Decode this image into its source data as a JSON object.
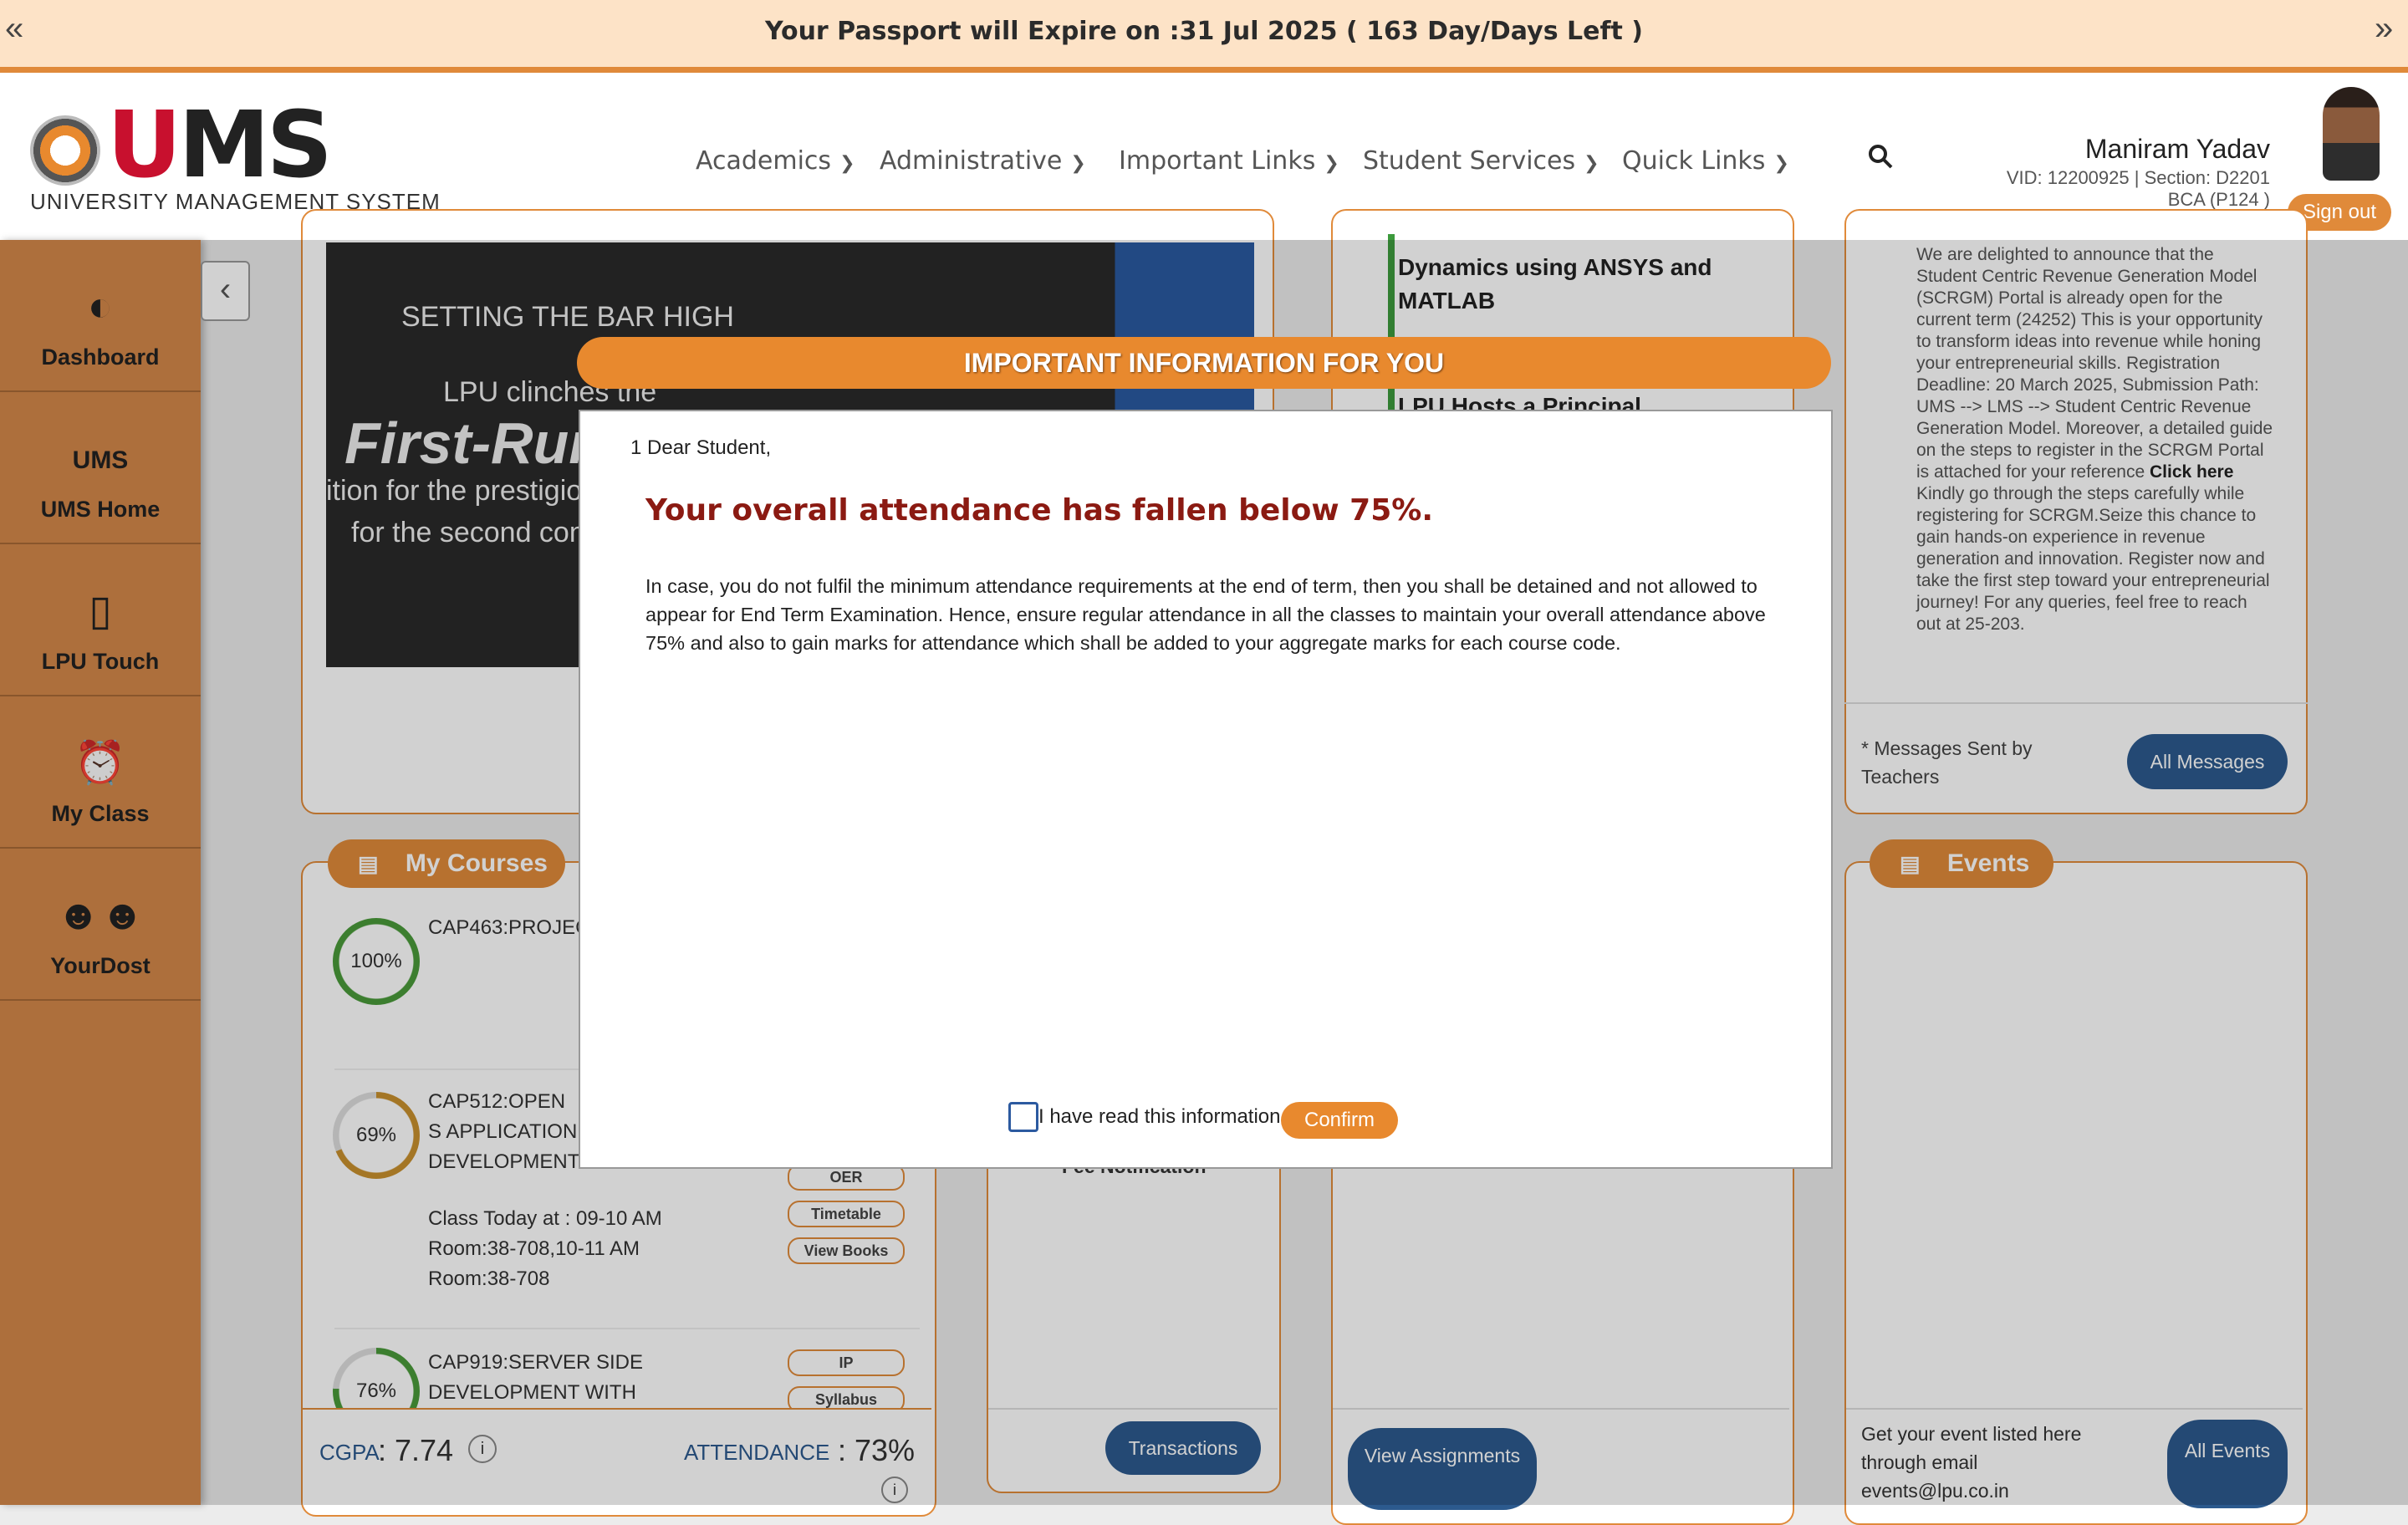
{
  "banner": {
    "text": "Your Passport will Expire on :31 Jul 2025 ( 163 Day/Days Left )",
    "left_chev": "«",
    "right_chev": "»"
  },
  "header": {
    "logo_text": "UMS",
    "logo_sub": "UNIVERSITY MANAGEMENT SYSTEM",
    "nav": [
      "Academics",
      "Administrative",
      "Important Links",
      "Student Services",
      "Quick Links"
    ],
    "user_name": "Maniram Yadav",
    "vid_line": "VID: 12200925 | Section: D2201",
    "program_line": "BCA (P124 )",
    "signout": "Sign out"
  },
  "sidebar": {
    "items": [
      {
        "label": "Dashboard",
        "icon": "speedometer-icon"
      },
      {
        "label": "UMS Home",
        "icon": "ums-logo-icon"
      },
      {
        "label": "LPU Touch",
        "icon": "mobile-phone-icon"
      },
      {
        "label": "My Class",
        "icon": "alarm-clock-icon"
      },
      {
        "label": "YourDost",
        "icon": "people-icon"
      }
    ]
  },
  "hero": {
    "line1": "SETTING THE BAR HIGH",
    "line2": "LPU clinches the",
    "line3": "First-Run",
    "line4": "ition for the prestigio",
    "line5": "for the second con"
  },
  "news": {
    "item1": "Dynamics using ANSYS and MATLAB",
    "item2": "LPU Hosts a Principal Conclave"
  },
  "messages": {
    "body": "We are delighted to announce that the Student Centric Revenue Generation Model (SCRGM) Portal is already open for the current term (24252) This is your opportunity to transform ideas into revenue while honing your entrepreneurial skills. Registration Deadline: 20 March 2025, Submission Path: UMS --> LMS --> Student Centric Revenue Generation Model. Moreover, a detailed guide on the steps to register in the SCRGM Portal is attached for your reference",
    "link": "Click here",
    "body2": "Kindly go through the steps carefully while registering for SCRGM.Seize this chance to gain hands-on experience in revenue generation and innovation. Register now and take the first step toward your entrepreneurial journey! For any queries, feel free to reach out at 25-203.",
    "footer": "* Messages Sent by Teachers",
    "button": "All Messages"
  },
  "courses": {
    "title": "My Courses",
    "items": [
      {
        "pct": "100%",
        "name": "CAP463:PROJEC"
      },
      {
        "pct": "69%",
        "name": "CAP512:OPEN S APPLICATION DEVELOPMENT",
        "class_info": "Class Today at : 09-10 AM Room:38-708,10-11 AM Room:38-708"
      },
      {
        "pct": "76%",
        "name": "CAP919:SERVER SIDE DEVELOPMENT WITH"
      }
    ],
    "tags": [
      "OER",
      "Timetable",
      "View Books",
      "IP",
      "Syllabus"
    ],
    "cgpa_label": "CGPA",
    "cgpa": ": 7.74",
    "attendance_label": "ATTENDANCE",
    "attendance": ": 73%"
  },
  "fees": {
    "fee_notification": "Fee Notification",
    "button": "Transactions"
  },
  "assignments": {
    "button": "View Assignments"
  },
  "events": {
    "title": "Events",
    "footer": "Get your event listed here through email events@lpu.co.in",
    "button": "All Events"
  },
  "modal": {
    "header": "IMPORTANT INFORMATION FOR YOU",
    "greeting": "1 Dear Student,",
    "headline": "Your overall attendance has fallen below 75%.",
    "body": "In case, you do not fulfil the minimum attendance requirements at the end of term, then you shall be detained and not allowed to appear for End Term Examination. Hence, ensure regular attendance in all the classes to maintain your overall attendance above 75% and also to gain marks for attendance which shall be added to your aggregate marks for each course code.",
    "checkbox_label": "I have read this information",
    "confirm": "Confirm"
  }
}
